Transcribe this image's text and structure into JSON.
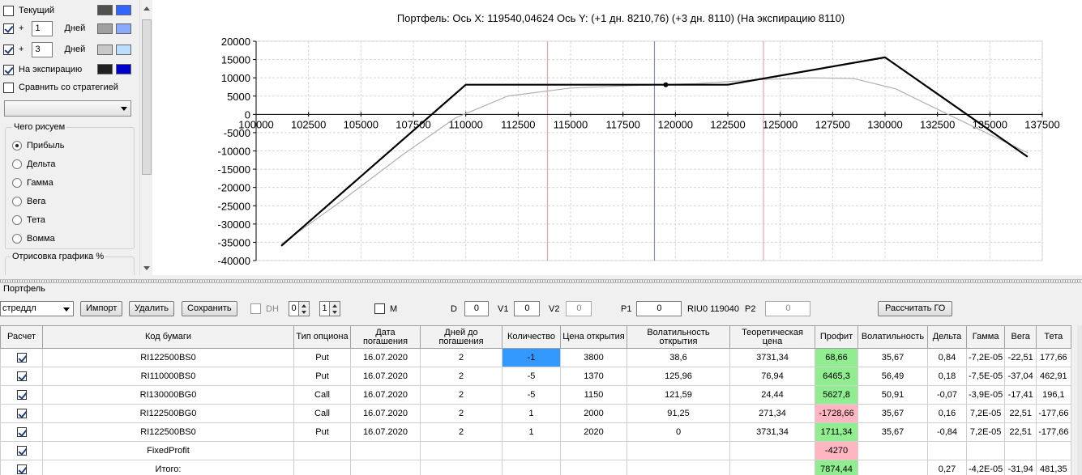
{
  "left_panel": {
    "current_label": "Текущий",
    "current_checked": false,
    "plus_sign": "+",
    "days_label": "Дней",
    "day_rows": [
      {
        "value": "1",
        "checked": true
      },
      {
        "value": "3",
        "checked": true
      }
    ],
    "expiration_label": "На экспирацию",
    "expiration_checked": true,
    "compare_label": "Сравнить со стратегией",
    "compare_checked": false,
    "strategy_selected": "",
    "draw_group_title": "Чего рисуем",
    "draw_options": [
      "Прибыль",
      "Дельта",
      "Гамма",
      "Вега",
      "Тета",
      "Вомма"
    ],
    "draw_selected": "Прибыль",
    "render_group_title": "Отрисовка графика %",
    "swatch_colors": {
      "current": [
        "#505050",
        "#3366ff"
      ],
      "day1": [
        "#a0a0a0",
        "#88aaff"
      ],
      "day3": [
        "#c8c8c8",
        "#bbddff"
      ],
      "expiration": [
        "#202020",
        "#0000cc"
      ]
    }
  },
  "chart": {
    "header": "Портфель: Ось X: 119540,04624 Ось Y:  (+1 дн. 8210,76)  (+3 дн. 8110)  (На экспирацию 8110)"
  },
  "chart_data": {
    "type": "line",
    "xlim": [
      100000,
      137500
    ],
    "ylim": [
      -40000,
      20000
    ],
    "x_ticks": [
      100000,
      102500,
      105000,
      107500,
      110000,
      112500,
      115000,
      117500,
      120000,
      122500,
      125000,
      127500,
      130000,
      132500,
      135000,
      137500
    ],
    "y_ticks": [
      20000,
      15000,
      10000,
      5000,
      0,
      -5000,
      -10000,
      -15000,
      -20000,
      -25000,
      -30000,
      -35000,
      -40000
    ],
    "grid": true,
    "series": [
      {
        "color": "#000000",
        "x": [
          101200,
          110000,
          122500,
          130000,
          136800
        ],
        "y": [
          -36000,
          8110,
          8110,
          15600,
          -11600
        ]
      },
      {
        "color": "#b0b0b0",
        "x": [
          101200,
          104000,
          107000,
          109500,
          112000,
          115000,
          118000,
          121000,
          124000,
          126500,
          128500,
          130500,
          133000,
          136800
        ],
        "y": [
          -35500,
          -24000,
          -11000,
          -1000,
          5000,
          7200,
          7900,
          8400,
          9500,
          10000,
          9800,
          7000,
          0,
          -10500
        ]
      }
    ],
    "vertical_lines": [
      {
        "x": 113900,
        "color": "#f2a0b0"
      },
      {
        "x": 119000,
        "color": "#8890b0"
      },
      {
        "x": 124200,
        "color": "#f2a0b0"
      }
    ],
    "marker": {
      "x": 119540,
      "y": 8110
    }
  },
  "portfolio": {
    "title": "Портфель",
    "strategy_name": "стреддл",
    "import_label": "Импорт",
    "delete_label": "Удалить",
    "save_label": "Сохранить",
    "dh_label": "DH",
    "dh_checked": false,
    "spin1": "0",
    "spin2": "1",
    "m_label": "M",
    "m_checked": false,
    "d_label": "D",
    "d_value": "0",
    "v1_label": "V1",
    "v1_value": "0",
    "v2_label": "V2",
    "v2_value": "0",
    "p1_label": "P1",
    "p1_value": "0",
    "riu_label": "RIU0 119040",
    "p2_label": "P2",
    "p2_value": "0",
    "calc_go_label": "Рассчитать ГО"
  },
  "table": {
    "columns": [
      "Расчет",
      "Код бумаги",
      "Тип опциона",
      "Дата погашения",
      "Дней до погашения",
      "Количество",
      "Цена открытия",
      "Волатильность открытия",
      "Теоретическая цена",
      "Профит",
      "Волатильность",
      "Дельта",
      "Гамма",
      "Вега",
      "Тета"
    ],
    "rows": [
      {
        "checked": true,
        "code": "RI122500BS0",
        "type": "Put",
        "date": "16.07.2020",
        "days": "2",
        "qty": "-1",
        "open": "3800",
        "vol_open": "38,6",
        "theo": "3731,34",
        "profit": "68,66",
        "profit_color": "green",
        "vol": "35,67",
        "delta": "0,84",
        "gamma": "-7,2E-05",
        "vega": "-22,51",
        "theta": "177,66",
        "qty_selected": true
      },
      {
        "checked": true,
        "code": "RI110000BS0",
        "type": "Put",
        "date": "16.07.2020",
        "days": "2",
        "qty": "-5",
        "open": "1370",
        "vol_open": "125,96",
        "theo": "76,94",
        "profit": "6465,3",
        "profit_color": "green",
        "vol": "56,49",
        "delta": "0,18",
        "gamma": "-7,5E-05",
        "vega": "-37,04",
        "theta": "462,91"
      },
      {
        "checked": true,
        "code": "RI130000BG0",
        "type": "Call",
        "date": "16.07.2020",
        "days": "2",
        "qty": "-5",
        "open": "1150",
        "vol_open": "121,59",
        "theo": "24,44",
        "profit": "5627,8",
        "profit_color": "green",
        "vol": "50,91",
        "delta": "-0,07",
        "gamma": "-3,9E-05",
        "vega": "-17,41",
        "theta": "196,1"
      },
      {
        "checked": true,
        "code": "RI122500BG0",
        "type": "Call",
        "date": "16.07.2020",
        "days": "2",
        "qty": "1",
        "open": "2000",
        "vol_open": "91,25",
        "theo": "271,34",
        "profit": "-1728,66",
        "profit_color": "pink",
        "vol": "35,67",
        "delta": "0,16",
        "gamma": "7,2E-05",
        "vega": "22,51",
        "theta": "-177,66"
      },
      {
        "checked": true,
        "code": "RI122500BS0",
        "type": "Put",
        "date": "16.07.2020",
        "days": "2",
        "qty": "1",
        "open": "2020",
        "vol_open": "0",
        "theo": "3731,34",
        "profit": "1711,34",
        "profit_color": "green",
        "vol": "35,67",
        "delta": "-0,84",
        "gamma": "7,2E-05",
        "vega": "22,51",
        "theta": "-177,66"
      },
      {
        "checked": true,
        "code": "FixedProfit",
        "type": "",
        "date": "",
        "days": "",
        "qty": "",
        "open": "",
        "vol_open": "",
        "theo": "",
        "profit": "-4270",
        "profit_color": "pink",
        "vol": "",
        "delta": "",
        "gamma": "",
        "vega": "",
        "theta": ""
      },
      {
        "checked": true,
        "code": "Итого:",
        "type": "",
        "date": "",
        "days": "",
        "qty": "",
        "open": "",
        "vol_open": "",
        "theo": "",
        "profit": "7874,44",
        "profit_color": "green",
        "vol": "",
        "delta": "0,27",
        "gamma": "-4,2E-05",
        "vega": "-31,94",
        "theta": "481,35"
      }
    ]
  }
}
